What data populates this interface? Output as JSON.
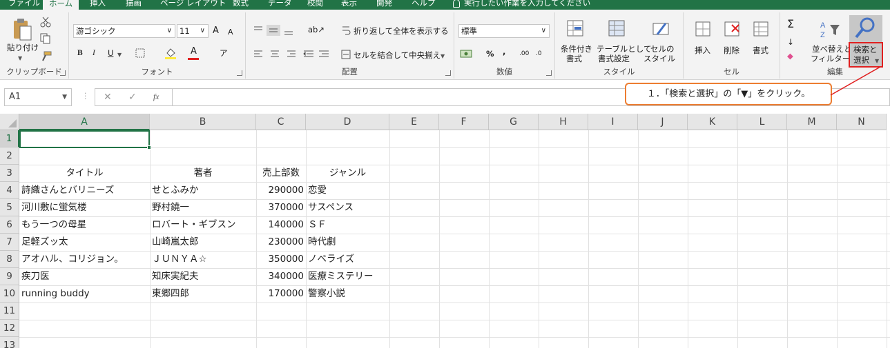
{
  "tabs": [
    "ファイル",
    "ホーム",
    "挿入",
    "描画",
    "ページ レイアウト",
    "数式",
    "データ",
    "校閲",
    "表示",
    "開発",
    "ヘルプ"
  ],
  "active_tab": "ホーム",
  "tell_me": "実行したい作業を入力してください",
  "ribbon": {
    "clipboard": {
      "label": "クリップボード",
      "paste": "貼り付け"
    },
    "font": {
      "label": "フォント",
      "name": "游ゴシック",
      "size": "11",
      "bold": "B",
      "italic": "I",
      "underline": "U",
      "grow": "A",
      "shrink": "A"
    },
    "alignment": {
      "label": "配置",
      "wrap": "折り返して全体を表示する",
      "merge": "セルを結合して中央揃え"
    },
    "number": {
      "label": "数値",
      "format": "標準",
      "percent": "%",
      "comma": ","
    },
    "styles": {
      "label": "スタイル",
      "conditional_1": "条件付き",
      "conditional_2": "書式",
      "table_1": "テーブルとして",
      "table_2": "書式設定",
      "cell_1": "セルの",
      "cell_2": "スタイル"
    },
    "cells": {
      "label": "セル",
      "insert": "挿入",
      "delete": "削除",
      "format": "書式"
    },
    "editing": {
      "label": "編集",
      "sort_1": "並べ替えと",
      "sort_2": "フィルター",
      "find_1": "検索と",
      "find_2": "選択"
    }
  },
  "name_box": "A1",
  "fx": "fx",
  "callout": "１．「検索と選択」の「▼」をクリック。",
  "colors": {
    "excel_green": "#217346",
    "highlight_red": "#e02020",
    "callout_border": "#ed7d31"
  },
  "columns": [
    "A",
    "B",
    "C",
    "D",
    "E",
    "F",
    "G",
    "H",
    "I",
    "J",
    "K",
    "L",
    "M",
    "N"
  ],
  "rows": [
    "1",
    "2",
    "3",
    "4",
    "5",
    "6",
    "7",
    "8",
    "9",
    "10",
    "11",
    "12",
    "13"
  ],
  "table": {
    "headers": [
      "タイトル",
      "著者",
      "売上部数",
      "ジャンル"
    ],
    "rows": [
      [
        "詩織さんとバリニーズ",
        "せとふみか",
        "290000",
        "恋愛"
      ],
      [
        "河川敷に蛍気楼",
        "野村鐃一",
        "370000",
        "サスペンス"
      ],
      [
        "もう一つの母星",
        "ロバート・ギブスン",
        "140000",
        "ＳＦ"
      ],
      [
        "足軽ズッ太",
        "山崎嵐太郎",
        "230000",
        "時代劇"
      ],
      [
        "アオハル、コリジョン。",
        "ＪＵＮＹＡ☆",
        "350000",
        "ノベライズ"
      ],
      [
        "疾刀医",
        "知床実紀夫",
        "340000",
        "医療ミステリー"
      ],
      [
        "running buddy",
        "東郷四郎",
        "170000",
        "警察小説"
      ]
    ]
  }
}
